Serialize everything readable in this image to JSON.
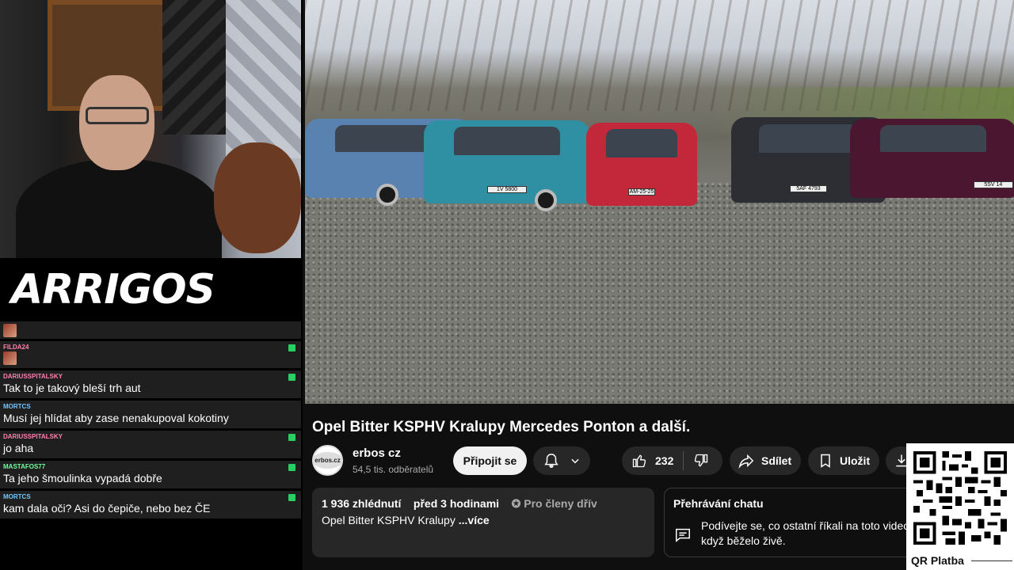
{
  "overlay": {
    "logo_text": "ARRIGOS"
  },
  "chat": {
    "messages": [
      {
        "user": "",
        "text": "",
        "emote": true,
        "first": true
      },
      {
        "user": "FILDA24",
        "text": "",
        "emote": true,
        "color": "pink"
      },
      {
        "user": "DARIUSSPITALSKY",
        "text": "Tak to je takový bleší trh aut",
        "color": "pink"
      },
      {
        "user": "MORTCS",
        "text": "Musí jej hlídat aby zase nenakupoval kokotiny",
        "color": "blue"
      },
      {
        "user": "DARIUSSPITALSKY",
        "text": "jo aha",
        "color": "pink"
      },
      {
        "user": "MASTAFOS77",
        "text": "Ta jeho šmoulinka vypadá dobře",
        "color": "green"
      },
      {
        "user": "MORTCS",
        "text": "kam dala oči? Asi do čepiče, nebo bez ČE",
        "color": "blue"
      }
    ]
  },
  "video": {
    "plates": [
      "1V 5800",
      "AM-25-25",
      "5AF 4793",
      "5SV 14"
    ],
    "title": "Opel Bitter KSPHV Kralupy Mercedes Ponton a další."
  },
  "channel": {
    "avatar_text": "erbos.cz",
    "name": "erbos cz",
    "subscribers": "54,5 tis. odběratelů",
    "join_label": "Připojit se"
  },
  "actions": {
    "likes": "232",
    "share_label": "Sdílet",
    "save_label": "Uložit"
  },
  "description": {
    "views": "1 936 zhlédnutí",
    "time": "před 3 hodinami",
    "members": "Pro členy dřív",
    "snippet": "Opel Bitter KSPHV Kralupy ",
    "more": "...více"
  },
  "chat_replay": {
    "heading": "Přehrávání chatu",
    "text_line1": "Podívejte se, co ostatní říkali na toto video,",
    "text_line2": "když běželo živě."
  },
  "qr": {
    "label": "QR Platba"
  },
  "colors": {
    "background": "#0f0f0f",
    "chat_bg": "#1f1f1f",
    "button_bg": "#272727",
    "badge_green": "#27d060"
  }
}
